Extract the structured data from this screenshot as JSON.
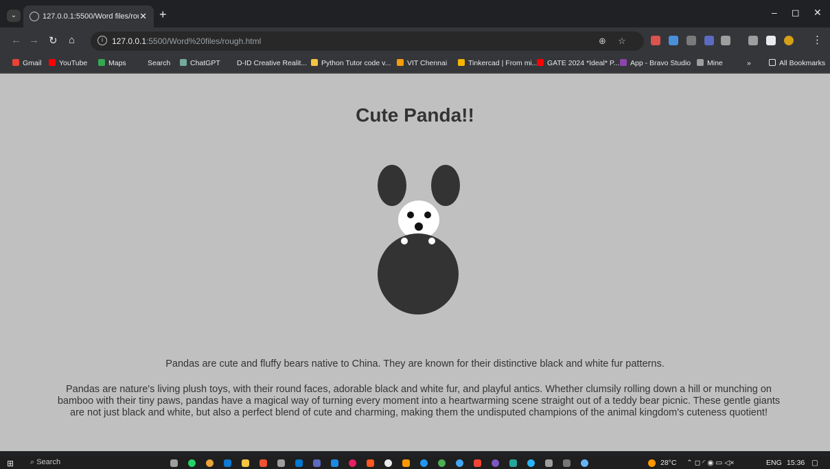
{
  "browser": {
    "tab_title": "127.0.0.1:5500/Word files/rougi",
    "tab_close": "✕",
    "new_tab": "+",
    "window_controls": {
      "minimize": "–",
      "maximize": "◻",
      "close": "✕"
    },
    "address": {
      "host": "127.0.0.1",
      "rest": ":5500/Word%20files/rough.html"
    },
    "bookmarks": [
      {
        "label": "Gmail",
        "color": "#ea4335"
      },
      {
        "label": "YouTube",
        "color": "#ff0000"
      },
      {
        "label": "Maps",
        "color": "#34a853"
      },
      {
        "label": "Search",
        "color": "#35363a"
      },
      {
        "label": "ChatGPT",
        "color": "#74aa9c"
      },
      {
        "label": "D-ID Creative Realit...",
        "color": "#35363a"
      },
      {
        "label": "Python Tutor code v...",
        "color": "#f4c542"
      },
      {
        "label": "VIT Chennai",
        "color": "#f59e0b"
      },
      {
        "label": "Tinkercad | From mi...",
        "color": "#f4b400"
      },
      {
        "label": "GATE 2024 *Ideal* P...",
        "color": "#ff0000"
      },
      {
        "label": "App - Bravo Studio",
        "color": "#8e44ad"
      },
      {
        "label": "Mine",
        "color": "#9e9e9e"
      },
      {
        "label": "»",
        "color": "#35363a"
      },
      {
        "label": "All Bookmarks",
        "color": "#35363a"
      }
    ]
  },
  "page": {
    "title": "Cute Panda!!",
    "para1": "Pandas are cute and fluffy bears native to China. They are known for their distinctive black and white fur patterns.",
    "para2": "Pandas are nature's living plush toys, with their round faces, adorable black and white fur, and playful antics. Whether clumsily rolling down a hill or munching on bamboo with their tiny paws, pandas have a magical way of turning every moment into a heartwarming scene straight out of a teddy bear picnic. These gentle giants are not just black and white, but also a perfect blend of cute and charming, making them the undisputed champions of the animal kingdom's cuteness quotient!",
    "colors": {
      "background": "#c0c0c0",
      "panda_dark": "#333333",
      "panda_light": "#ffffff"
    }
  },
  "taskbar": {
    "search": "Search",
    "temperature": "28°C",
    "language": "ENG",
    "time": "15:36"
  }
}
